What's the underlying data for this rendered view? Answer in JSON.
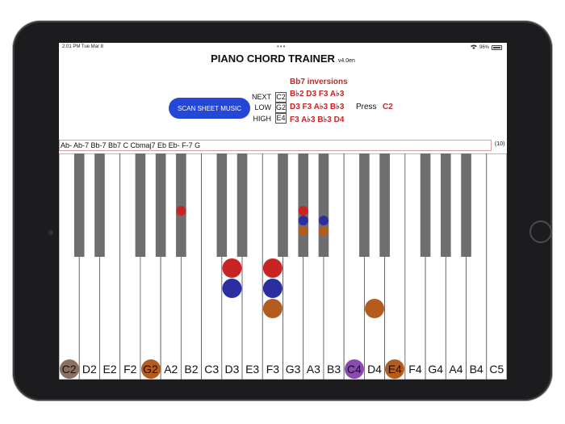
{
  "status": {
    "time": "2:01 PM  Tue Mar 8",
    "battery": "96%",
    "dots": "•••"
  },
  "app": {
    "title": "PIANO CHORD TRAINER",
    "version": "v4.0en"
  },
  "scan_button": "SCAN SHEET MUSIC",
  "range": {
    "next_label": "NEXT",
    "next_value": "C2",
    "low_label": "LOW",
    "low_value": "G2",
    "high_label": "HIGH",
    "high_value": "E4"
  },
  "inversions": {
    "title": "Bb7 inversions",
    "lines": [
      "B♭2 D3 F3 A♭3",
      "D3 F3 A♭3 B♭3",
      "F3 A♭3 B♭3 D4"
    ],
    "press_label": "Press",
    "press_note": "C2"
  },
  "progression": "Ab- Ab-7 Bb-7 Bb7 C Cbmaj7 Eb Eb- F-7 G",
  "progression_count": "(10)",
  "white_keys": [
    "C2",
    "D2",
    "E2",
    "F2",
    "G2",
    "A2",
    "B2",
    "C3",
    "D3",
    "E3",
    "F3",
    "G3",
    "A3",
    "B3",
    "C4",
    "D4",
    "E4",
    "F4",
    "G4",
    "A4",
    "B4",
    "C5"
  ],
  "note_highlights": [
    {
      "note": "C2",
      "color": "#8a7060"
    },
    {
      "note": "G2",
      "color": "#b35c1e"
    },
    {
      "note": "C4",
      "color": "#8a4bb0"
    },
    {
      "note": "E4",
      "color": "#b35c1e"
    }
  ],
  "colors": {
    "red": "#c82424",
    "blue": "#2a2ea0",
    "brown": "#b35c1e",
    "button": "#2547d8"
  }
}
